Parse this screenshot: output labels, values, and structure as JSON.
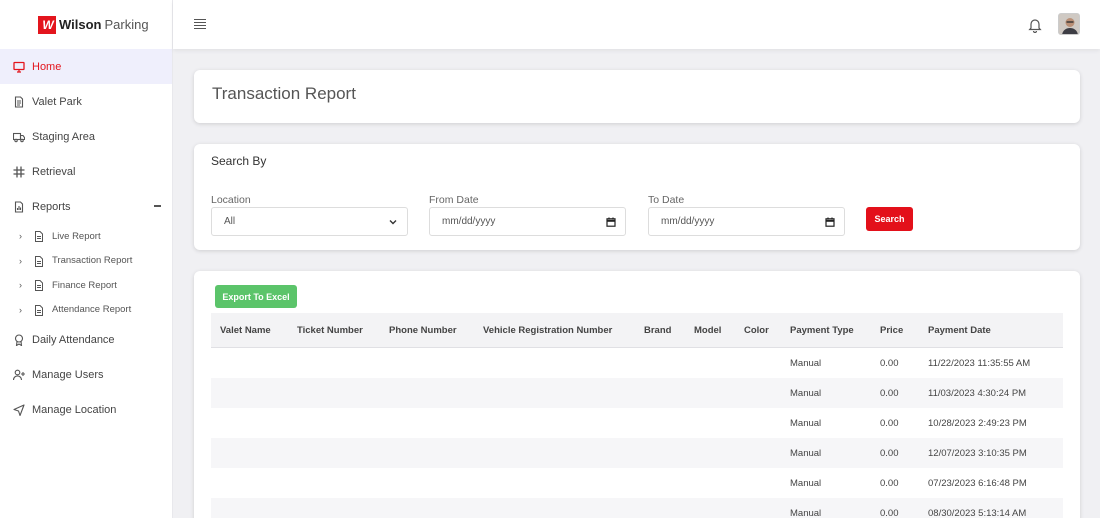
{
  "brand": {
    "bold": "Wilson",
    "rest": "Parking",
    "mark": "W"
  },
  "sidebar": {
    "items": [
      {
        "label": "Home",
        "icon": "monitor-icon"
      },
      {
        "label": "Valet Park",
        "icon": "document-icon"
      },
      {
        "label": "Staging Area",
        "icon": "truck-icon"
      },
      {
        "label": "Retrieval",
        "icon": "slack-icon"
      },
      {
        "label": "Reports",
        "icon": "report-icon"
      }
    ],
    "sub_items": [
      {
        "label": "Live Report"
      },
      {
        "label": "Transaction Report"
      },
      {
        "label": "Finance Report"
      },
      {
        "label": "Attendance Report"
      }
    ],
    "bottom_items": [
      {
        "label": "Daily Attendance",
        "icon": "award-icon"
      },
      {
        "label": "Manage Users",
        "icon": "user-plus-icon"
      },
      {
        "label": "Manage Location",
        "icon": "navigation-icon"
      }
    ]
  },
  "page": {
    "title": "Transaction Report"
  },
  "search": {
    "title": "Search By",
    "location_label": "Location",
    "location_value": "All",
    "from_label": "From Date",
    "from_value": "mm/dd/yyyy",
    "to_label": "To Date",
    "to_value": "mm/dd/yyyy",
    "button": "Search"
  },
  "table": {
    "export_label": "Export To Excel",
    "columns": [
      "Valet Name",
      "Ticket Number",
      "Phone Number",
      "Vehicle Registration Number",
      "Brand",
      "Model",
      "Color",
      "Payment Type",
      "Price",
      "Payment Date"
    ],
    "rows": [
      {
        "payment_type": "Manual",
        "price": "0.00",
        "payment_date": "11/22/2023 11:35:55 AM"
      },
      {
        "payment_type": "Manual",
        "price": "0.00",
        "payment_date": "11/03/2023 4:30:24 PM"
      },
      {
        "payment_type": "Manual",
        "price": "0.00",
        "payment_date": "10/28/2023 2:49:23 PM"
      },
      {
        "payment_type": "Manual",
        "price": "0.00",
        "payment_date": "12/07/2023 3:10:35 PM"
      },
      {
        "payment_type": "Manual",
        "price": "0.00",
        "payment_date": "07/23/2023 6:16:48 PM"
      },
      {
        "payment_type": "Manual",
        "price": "0.00",
        "payment_date": "08/30/2023 5:13:14 AM"
      }
    ]
  },
  "colors": {
    "accent": "#e3151d",
    "export": "#5bc46a",
    "active_bg": "#efeffc"
  }
}
